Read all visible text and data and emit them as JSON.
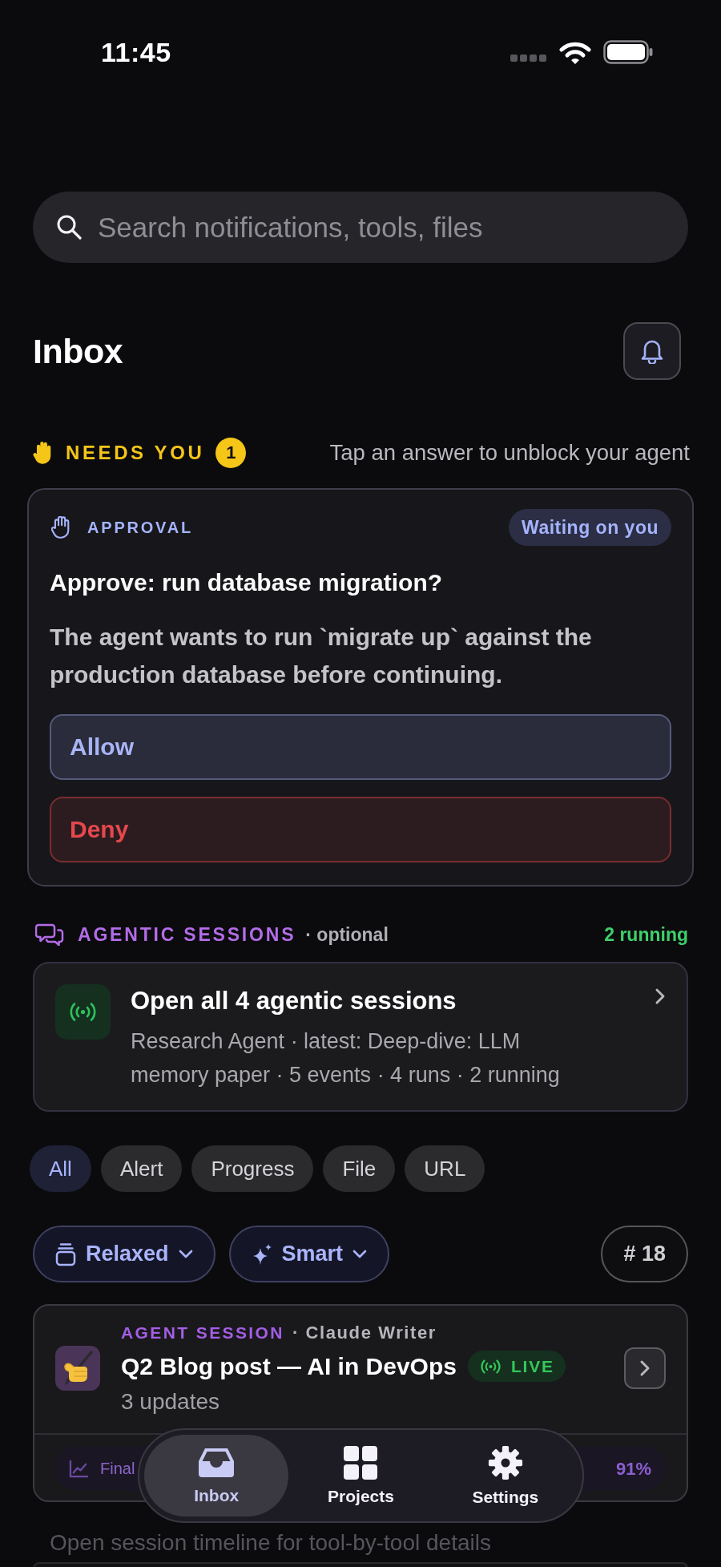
{
  "status_bar": {
    "time": "11:45"
  },
  "search": {
    "placeholder": "Search notifications, tools, files"
  },
  "header": {
    "title": "Inbox"
  },
  "needs_you": {
    "title": "NEEDS YOU",
    "count": "1",
    "hint": "Tap an answer to unblock your agent",
    "cards": [
      {
        "kind": "approval",
        "label": "APPROVAL",
        "status": "Waiting on you",
        "title": "Approve: run database migration?",
        "body": "The agent wants to run `migrate up` against the production database before continuing.",
        "actions": [
          {
            "kind": "allow",
            "label": "Allow"
          },
          {
            "kind": "deny",
            "label": "Deny"
          }
        ]
      }
    ]
  },
  "agentic_sessions": {
    "title": "AGENTIC SESSIONS",
    "note": "· optional",
    "running": "2 running",
    "card": {
      "title": "Open all 4 agentic sessions",
      "subtitle": "Research Agent · latest: Deep-dive: LLM memory paper · 5 events · 4 runs · 2 running"
    }
  },
  "filters": [
    {
      "label": "All",
      "selected": true
    },
    {
      "label": "Alert",
      "selected": false
    },
    {
      "label": "Progress",
      "selected": false
    },
    {
      "label": "File",
      "selected": false
    },
    {
      "label": "URL",
      "selected": false
    }
  ],
  "view_controls": {
    "density": "Relaxed",
    "sort": "Smart",
    "count": "# 18"
  },
  "feed": [
    {
      "kind": "agent_session",
      "type_label": "AGENT SESSION",
      "source": "· Claude Writer",
      "title": "Q2 Blog post — AI in DevOps",
      "live": true,
      "live_label": "LIVE",
      "updates": "3 updates",
      "progress": {
        "label": "Final",
        "value": "91%"
      },
      "hint": "Open session timeline for tool-by-tool details"
    }
  ],
  "tab_bar": {
    "items": [
      {
        "label": "Inbox",
        "selected": true
      },
      {
        "label": "Projects",
        "selected": false
      },
      {
        "label": "Settings",
        "selected": false
      }
    ]
  }
}
